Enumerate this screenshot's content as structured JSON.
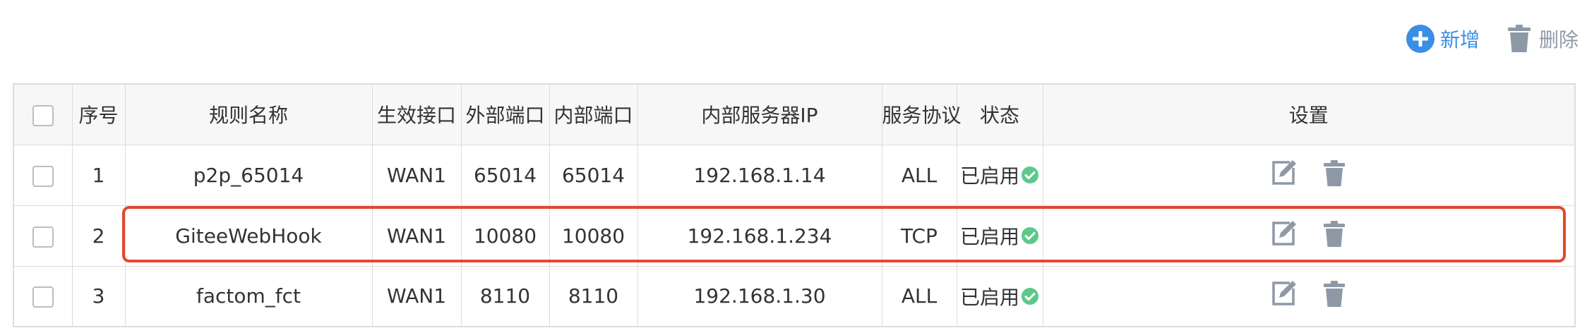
{
  "toolbar": {
    "add_label": "新增",
    "delete_label": "删除",
    "add_icon": "plus-circle-icon",
    "delete_icon": "trash-icon",
    "add_color": "#3a8ee6",
    "delete_color": "#8e99a6"
  },
  "table": {
    "columns": [
      "序号",
      "规则名称",
      "生效接口",
      "外部端口",
      "内部端口",
      "内部服务器IP",
      "服务协议",
      "状态",
      "设置"
    ],
    "rows": [
      {
        "index": "1",
        "name": "p2p_65014",
        "interface": "WAN1",
        "ext_port": "65014",
        "int_port": "65014",
        "server_ip": "192.168.1.14",
        "protocol": "ALL",
        "status": "已启用"
      },
      {
        "index": "2",
        "name": "GiteeWebHook",
        "interface": "WAN1",
        "ext_port": "10080",
        "int_port": "10080",
        "server_ip": "192.168.1.234",
        "protocol": "TCP",
        "status": "已启用"
      },
      {
        "index": "3",
        "name": "factom_fct",
        "interface": "WAN1",
        "ext_port": "8110",
        "int_port": "8110",
        "server_ip": "192.168.1.30",
        "protocol": "ALL",
        "status": "已启用"
      }
    ]
  },
  "colors": {
    "status_ok": "#5cc98a",
    "action_icon": "#8e99a6",
    "highlight_border": "#e5472e",
    "header_bg": "#f7f7f7",
    "border": "#dcdcdc"
  },
  "icons": {
    "status": "check-circle-icon",
    "edit": "edit-icon",
    "delete": "trash-icon"
  }
}
